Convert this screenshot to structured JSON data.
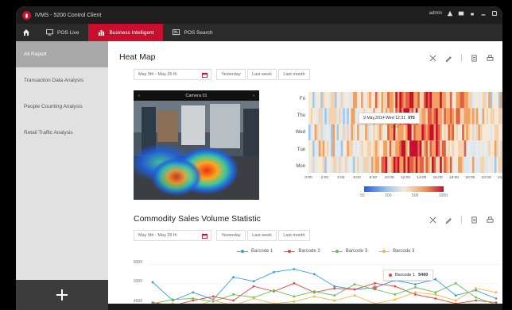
{
  "app": {
    "title": "IVMS - 5200 Control Client",
    "user": "admin"
  },
  "tabs": [
    {
      "label": "POS Live",
      "icon": "monitor-icon"
    },
    {
      "label": "Business Intelligent",
      "icon": "chart-icon",
      "active": true
    },
    {
      "label": "POS Search",
      "icon": "search-icon"
    }
  ],
  "sidebar": {
    "items": [
      {
        "label": "All Report",
        "active": true
      },
      {
        "label": "Transaction Data Analysis"
      },
      {
        "label": "People Counting Analysis"
      },
      {
        "label": "Retail Traffic Analysis"
      }
    ]
  },
  "heatmap": {
    "title": "Heat Map",
    "date_range": "May 9th - May 26 th",
    "btn_yesterday": "Yesterday",
    "btn_lastweek": "Last week",
    "btn_lastmonth": "Last month",
    "camera_name": "Camera 01",
    "days": [
      "Fri",
      "Thu",
      "Wed",
      "Tue",
      "Mon"
    ],
    "x_ticks": [
      "0:00",
      "2:00",
      "4:00",
      "6:00",
      "8:00",
      "10:00",
      "12:00",
      "14:00",
      "16:00",
      "18:00",
      "20:00",
      "22:00",
      "24:00"
    ],
    "tooltip_label": "9 May,2014 Wed 12:31",
    "tooltip_value": "975",
    "scale_ticks": [
      "50",
      "200",
      "500",
      "1000"
    ]
  },
  "sales": {
    "title": "Commodity Sales Volume Statistic",
    "date_range": "May 9th - May 26 th",
    "btn_yesterday": "Yesterday",
    "btn_lastweek": "Last week",
    "btn_lastmonth": "Last month",
    "legend": [
      "Barcode 1",
      "Barcode 2",
      "Barcode 3",
      "Barcode 3"
    ],
    "y_ticks": [
      "8000",
      "6000",
      "4000"
    ],
    "tooltip_label": "Barcode 1",
    "tooltip_value": "5460"
  },
  "chart_data": {
    "type": "line",
    "title": "Commodity Sales Volume Statistic",
    "ylim": [
      3500,
      8500
    ],
    "x": [
      1,
      2,
      3,
      4,
      5,
      6,
      7,
      8,
      9,
      10,
      11,
      12,
      13,
      14,
      15,
      16,
      17,
      18
    ],
    "series": [
      {
        "name": "Barcode 1",
        "color": "#3a9be0",
        "values": [
          6000,
          4200,
          5000,
          4300,
          6500,
          6100,
          7000,
          7300,
          6800,
          5600,
          5300,
          5460,
          6200,
          5800,
          6300,
          4700,
          5200,
          4400
        ]
      },
      {
        "name": "Barcode 2",
        "color": "#e8453c",
        "values": [
          4000,
          3700,
          4200,
          4600,
          4200,
          5600,
          5100,
          5900,
          5000,
          5400,
          5300,
          5900,
          5600,
          4800,
          4400,
          3900,
          4200,
          4000
        ]
      },
      {
        "name": "Barcode 3",
        "color": "#61c253",
        "values": [
          3900,
          4300,
          4400,
          4100,
          4800,
          4500,
          5200,
          4600,
          5100,
          4700,
          5800,
          5300,
          4800,
          5500,
          5000,
          5900,
          4500,
          3800
        ]
      },
      {
        "name": "Barcode 3",
        "color": "#f4b642",
        "values": [
          3700,
          3900,
          3600,
          4200,
          3700,
          4400,
          3900,
          4100,
          4600,
          4200,
          4700,
          3900,
          4300,
          5000,
          4800,
          4200,
          5400,
          5000
        ]
      }
    ]
  },
  "colors": {
    "brand": "#c8102e",
    "sidebar_active": "#a9a9a9",
    "dark": "#2b2b2b"
  }
}
